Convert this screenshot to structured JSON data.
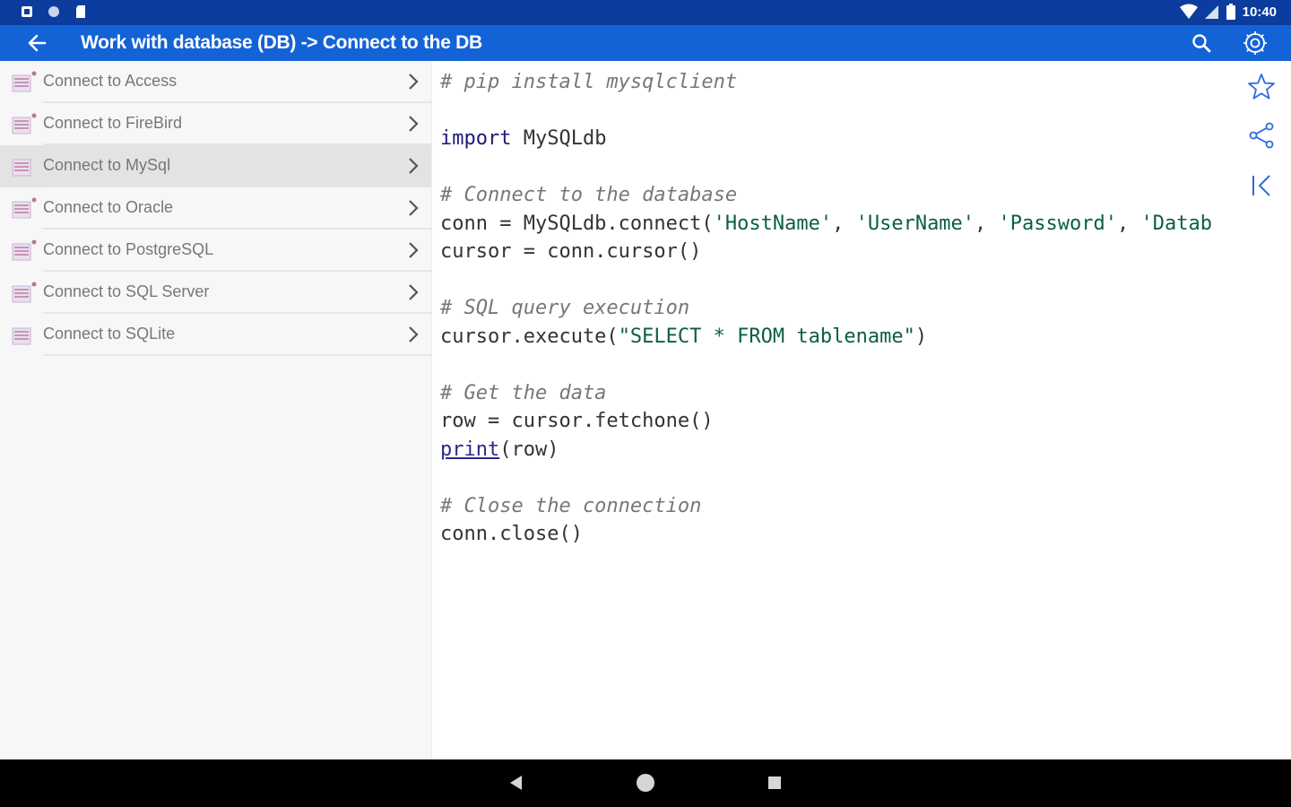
{
  "status_bar": {
    "time": "10:40",
    "left_icons": [
      "notification-icon",
      "circle-icon",
      "sd-card-icon"
    ],
    "right_icons": [
      "wifi-icon",
      "signal-icon",
      "battery-icon"
    ]
  },
  "app_bar": {
    "title": "Work with database (DB) -> Connect to the DB",
    "color": "#1463d6"
  },
  "sidebar": {
    "items": [
      {
        "label": "Connect to Access",
        "selected": false
      },
      {
        "label": "Connect to FireBird",
        "selected": false
      },
      {
        "label": "Connect to MySql",
        "selected": true
      },
      {
        "label": "Connect to Oracle",
        "selected": false
      },
      {
        "label": "Connect to PostgreSQL",
        "selected": false
      },
      {
        "label": "Connect to SQL Server",
        "selected": false
      },
      {
        "label": "Connect to SQLite",
        "selected": false
      }
    ]
  },
  "code": {
    "lines": [
      "# pip install mysqlclient",
      "",
      "import MySQLdb",
      "",
      "# Connect to the database",
      "conn = MySQLdb.connect('HostName', 'UserName', 'Password', 'Datab",
      "cursor = conn.cursor()",
      "",
      "# SQL query execution",
      "cursor.execute(\"SELECT * FROM tablename\")",
      "",
      "# Get the data",
      "row = cursor.fetchone()",
      "print(row)",
      "",
      "# Close the connection",
      "conn.close()"
    ]
  },
  "side_tools": [
    "star-icon",
    "share-icon",
    "collapse-icon"
  ],
  "nav_bar": [
    "back-triangle-icon",
    "home-circle-icon",
    "recents-square-icon"
  ]
}
